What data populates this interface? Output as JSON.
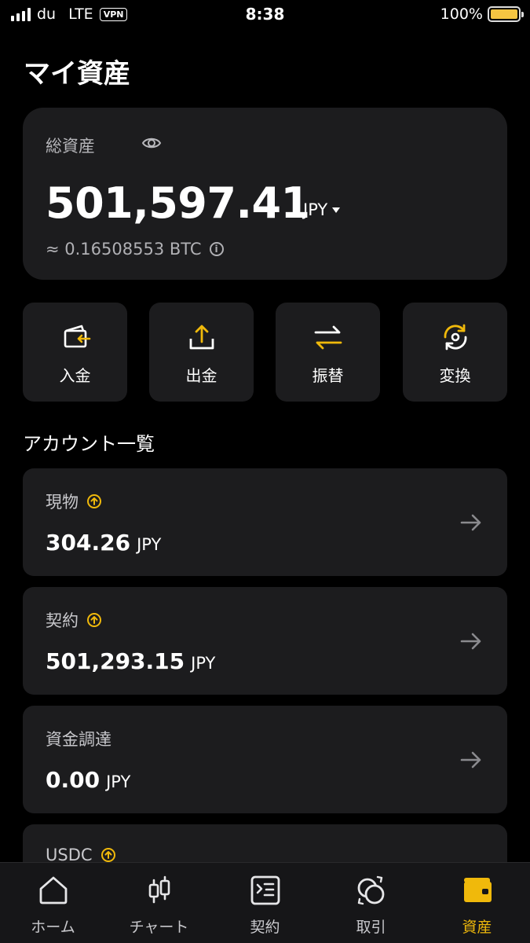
{
  "status_bar": {
    "carrier": "du",
    "network": "LTE",
    "vpn": "VPN",
    "time": "8:38",
    "battery": "100%"
  },
  "page_title": "マイ資産",
  "total": {
    "label": "総資産",
    "value": "501,597.41",
    "currency": "JPY",
    "btc_equivalent": "≈ 0.16508553 BTC"
  },
  "actions": [
    {
      "label": "入金",
      "icon": "deposit-icon"
    },
    {
      "label": "出金",
      "icon": "withdraw-icon"
    },
    {
      "label": "振替",
      "icon": "transfer-icon"
    },
    {
      "label": "変換",
      "icon": "convert-icon"
    }
  ],
  "section_title": "アカウント一覧",
  "accounts": [
    {
      "name": "現物",
      "value": "304.26",
      "currency": "JPY",
      "has_up_icon": true
    },
    {
      "name": "契約",
      "value": "501,293.15",
      "currency": "JPY",
      "has_up_icon": true
    },
    {
      "name": "資金調達",
      "value": "0.00",
      "currency": "JPY",
      "has_up_icon": false
    },
    {
      "name": "USDC",
      "value": "",
      "currency": "",
      "has_up_icon": true
    }
  ],
  "bottom_nav": [
    {
      "label": "ホーム",
      "icon": "home-icon",
      "active": false
    },
    {
      "label": "チャート",
      "icon": "candlestick-icon",
      "active": false
    },
    {
      "label": "契約",
      "icon": "contract-icon",
      "active": false
    },
    {
      "label": "取引",
      "icon": "trade-icon",
      "active": false
    },
    {
      "label": "資産",
      "icon": "wallet-icon",
      "active": true
    }
  ],
  "colors": {
    "accent": "#f0b90b",
    "card": "#1c1c1e",
    "background": "#000000"
  }
}
